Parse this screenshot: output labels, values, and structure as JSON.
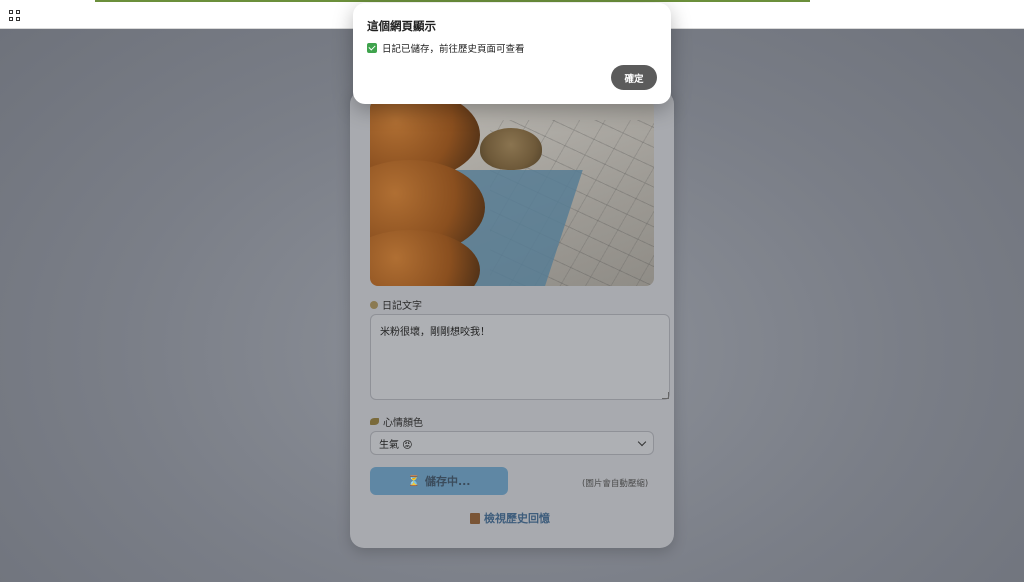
{
  "dialog": {
    "title": "這個網頁顯示",
    "message": "日記已儲存，前往歷史頁面可查看",
    "ok_label": "確定"
  },
  "form": {
    "text_label": "日記文字",
    "text_value": "米粉很壞，剛剛想咬我！",
    "mood_label": "心情顏色",
    "mood_value": "生氣 😡",
    "save_label": "儲存中...",
    "save_icon": "⏳",
    "hint": "(圖片會自動壓縮)",
    "history_link": "檢視歷史回憶"
  },
  "colors": {
    "accent": "#5f87a4",
    "ok_button": "#5b5b5b",
    "check": "#3fa34d"
  }
}
